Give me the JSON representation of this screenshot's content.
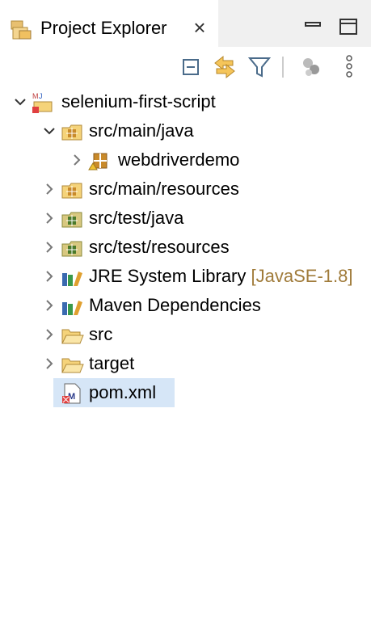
{
  "view": {
    "title": "Project Explorer",
    "close_glyph": "×"
  },
  "toolbar": {
    "icons": [
      "collapse-all-icon",
      "link-with-editor-icon",
      "filter-icon",
      "focus-on-active-task-icon",
      "view-menu-icon"
    ]
  },
  "tree": {
    "root": {
      "label": "selenium-first-script",
      "expanded": true
    },
    "items": [
      {
        "label": "src/main/java",
        "expanded": true
      },
      {
        "label": "webdriverdemo",
        "expanded": false
      },
      {
        "label": "src/main/resources",
        "expanded": false
      },
      {
        "label": "src/test/java",
        "expanded": false
      },
      {
        "label": "src/test/resources",
        "expanded": false
      },
      {
        "label": "JRE System Library",
        "decoration": "[JavaSE-1.8]",
        "expanded": false
      },
      {
        "label": "Maven Dependencies",
        "expanded": false
      },
      {
        "label": "src",
        "expanded": false
      },
      {
        "label": "target",
        "expanded": false
      },
      {
        "label": "pom.xml",
        "selected": true
      }
    ]
  },
  "colors": {
    "selection": "#d6e6f7",
    "decoration": "#a07b3a",
    "header_bg": "#f0f0f0"
  }
}
